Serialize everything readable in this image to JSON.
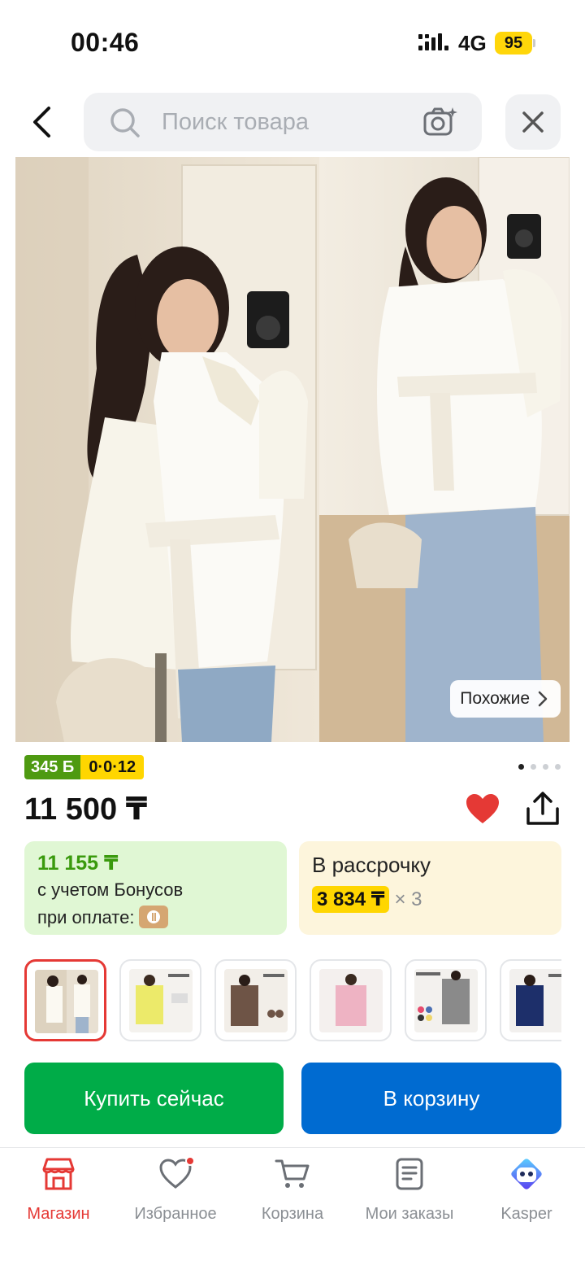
{
  "status_bar": {
    "time": "00:46",
    "network": "4G",
    "battery": "95"
  },
  "header": {
    "search_placeholder": "Поиск товара"
  },
  "gallery": {
    "similar_label": "Похожие",
    "dots_total": 4,
    "dot_active": 1
  },
  "badges": {
    "bonus": "345 Б",
    "installment": "0·0·12"
  },
  "price": {
    "main": "11 500 ₸"
  },
  "bonus_card": {
    "price": "11 155 ₸",
    "line1": "с учетом Бонусов",
    "line2": "при оплате:"
  },
  "installment_card": {
    "title": "В рассрочку",
    "amount": "3 834 ₸",
    "times": "× 3"
  },
  "buttons": {
    "buy_now": "Купить сейчас",
    "add_to_cart": "В корзину"
  },
  "bottom_nav": {
    "items": [
      {
        "label": "Магазин",
        "icon": "store-icon",
        "active": true
      },
      {
        "label": "Избранное",
        "icon": "heart-icon",
        "active": false
      },
      {
        "label": "Корзина",
        "icon": "cart-icon",
        "active": false
      },
      {
        "label": "Мои заказы",
        "icon": "orders-icon",
        "active": false
      },
      {
        "label": "Kasper",
        "icon": "kasper-assistant-icon",
        "active": false
      }
    ]
  },
  "colors": {
    "brand_red": "#e53935",
    "buy_green": "#00ac48",
    "cart_blue": "#006bd1",
    "bonus_green": "#4e9a11",
    "installment_yellow": "#ffd600"
  }
}
